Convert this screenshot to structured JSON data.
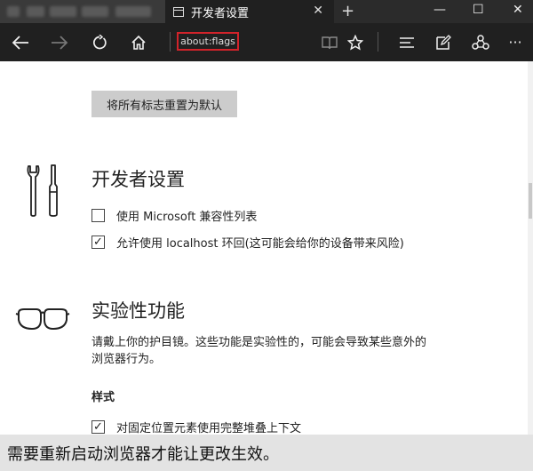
{
  "tabs": {
    "active_title": "开发者设置",
    "close_glyph": "✕",
    "new_tab_glyph": "+"
  },
  "window_controls": {
    "minimize": "—",
    "maximize": "☐",
    "close": "✕"
  },
  "address_bar": {
    "url": "about:flags"
  },
  "nav": {
    "icons": [
      "back-icon",
      "forward-icon",
      "refresh-icon",
      "home-icon",
      "reading-view-icon",
      "favorite-star-icon",
      "hub-icon",
      "web-note-icon",
      "share-icon",
      "more-icon"
    ],
    "more_glyph": "···"
  },
  "reset_button": {
    "label": "将所有标志重置为默认"
  },
  "developer_settings": {
    "title": "开发者设置",
    "icon": "tools-icon",
    "options": [
      {
        "label": "使用 Microsoft 兼容性列表",
        "checked": false
      },
      {
        "label": "允许使用 localhost 环回(这可能会给你的设备带来风险)",
        "checked": true
      }
    ]
  },
  "experimental": {
    "title": "实验性功能",
    "icon": "goggles-icon",
    "description": "请戴上你的护目镜。这些功能是实验性的，可能会导致某些意外的浏览器行为。",
    "style_heading": "样式",
    "options": [
      {
        "label": "对固定位置元素使用完整堆叠上下文",
        "checked": true
      }
    ]
  },
  "check_glyph": "✓",
  "restart_notice": "需要重新启动浏览器才能让更改生效。",
  "colors": {
    "chrome_dark": "#202020",
    "address_highlight": "#d2232a",
    "button_gray": "#cccccc",
    "notice_bg": "#e3e3e3"
  }
}
